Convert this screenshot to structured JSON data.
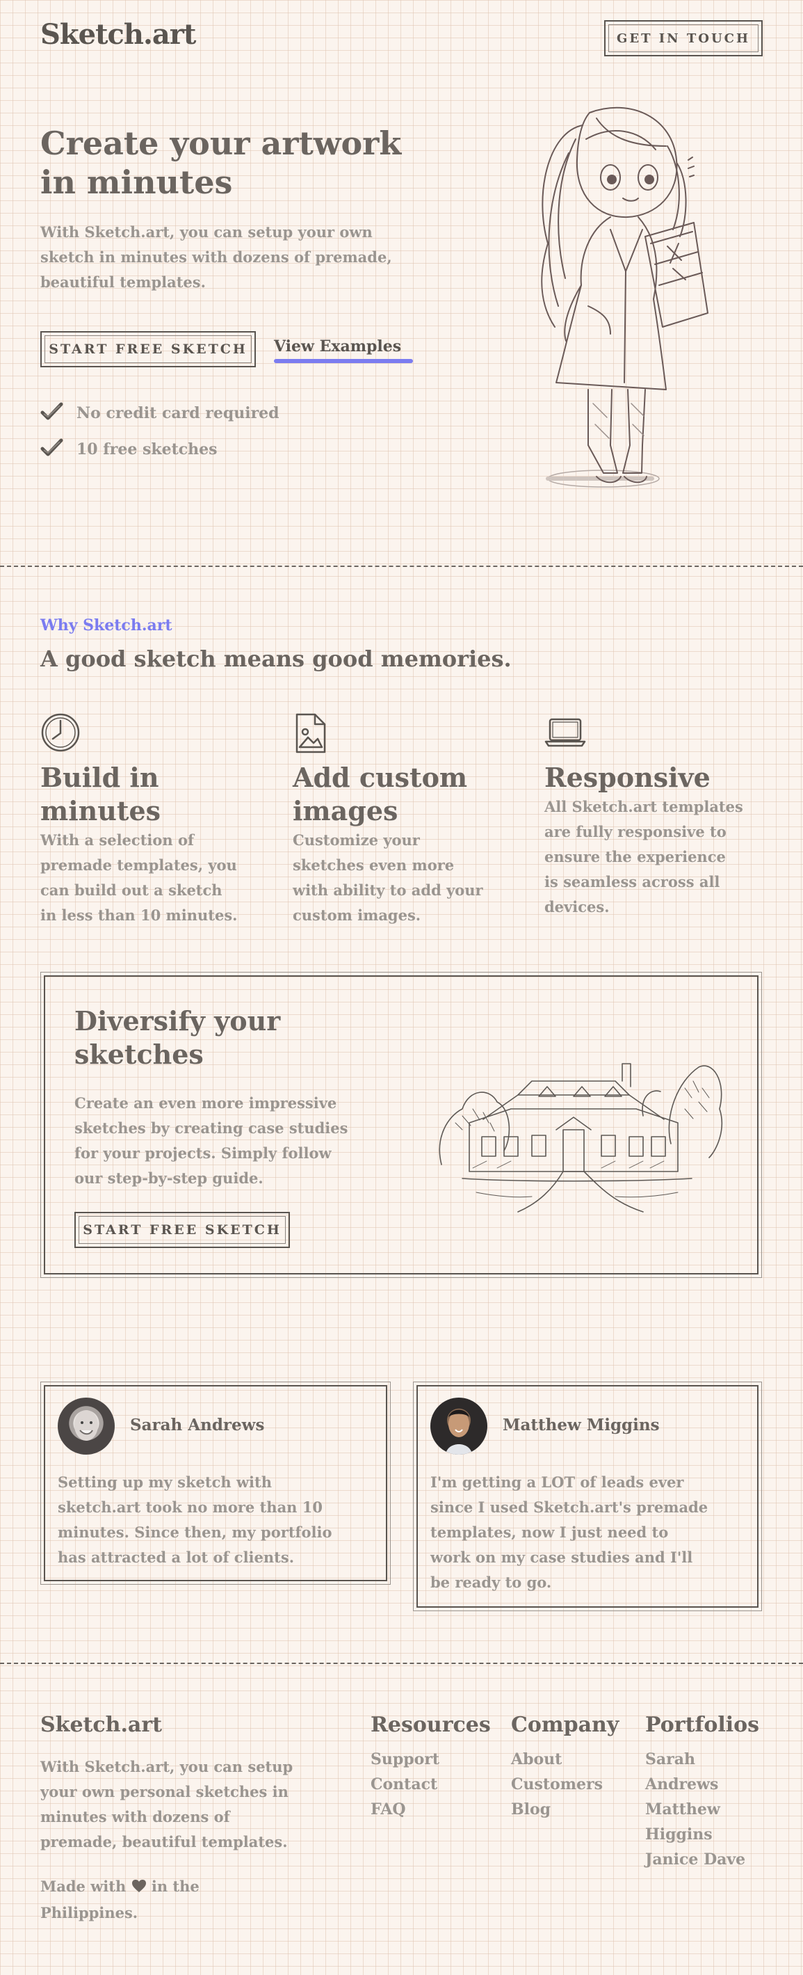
{
  "header": {
    "logo": "Sketch.art",
    "cta_label": "GET IN TOUCH"
  },
  "hero": {
    "title_line1": "Create your artwork",
    "title_line2": "in minutes",
    "description_line1": "With Sketch.art, you can setup your own",
    "description_line2": "sketch in minutes with dozens of premade,",
    "description_line3": "beautiful templates.",
    "primary_button": "START FREE SKETCH",
    "secondary_link": "View Examples",
    "checks": [
      "No credit card required",
      "10 free sketches"
    ]
  },
  "why": {
    "eyebrow": "Why Sketch.art",
    "heading": "A good sketch means good memories.",
    "features": [
      {
        "icon": "clock-icon",
        "title_line1": "Build in",
        "title_line2": "minutes",
        "lines": [
          "With a selection of",
          "premade templates, you",
          "can build out a sketch",
          "in less than 10 minutes."
        ]
      },
      {
        "icon": "image-file-icon",
        "title_line1": "Add custom",
        "title_line2": "images",
        "lines": [
          "Customize your",
          "sketches even more",
          "with ability to add your",
          "custom images."
        ]
      },
      {
        "icon": "laptop-icon",
        "title_line1": "Responsive",
        "title_line2": "",
        "lines": [
          "All Sketch.art templates",
          "are fully responsive to",
          "ensure the experience",
          "is seamless across all",
          "devices."
        ]
      }
    ]
  },
  "diversify": {
    "title_line1": "Diversify your",
    "title_line2": "sketches",
    "lines": [
      "Create an even more impressive",
      "sketches by creating case studies",
      "for your projects. Simply follow",
      "our step-by-step guide."
    ],
    "button": "START FREE SKETCH"
  },
  "testimonials": [
    {
      "name": "Sarah Andrews",
      "lines": [
        "Setting up my sketch with",
        "sketch.art took no more than 10",
        "minutes. Since then, my portfolio",
        "has attracted a lot of clients."
      ]
    },
    {
      "name": "Matthew Miggins",
      "lines": [
        "I'm getting a LOT of leads ever",
        "since I used Sketch.art's premade",
        "templates, now I just need to",
        "work on my case studies and I'll",
        "be ready to go."
      ]
    }
  ],
  "footer": {
    "logo": "Sketch.art",
    "lines": [
      "With Sketch.art, you can setup",
      "your own personal sketches in",
      "minutes with dozens of",
      "premade, beautiful templates."
    ],
    "made_with_prefix": "Made with",
    "made_with_suffix": "in the",
    "made_with_line2": "Philippines.",
    "columns": [
      {
        "heading": "Resources",
        "links": [
          "Support",
          "Contact",
          "FAQ"
        ]
      },
      {
        "heading": "Company",
        "links": [
          "About",
          "Customers",
          "Blog"
        ]
      },
      {
        "heading": "Portfolios",
        "links": [
          "Sarah",
          "Andrews",
          "Matthew",
          "Higgins",
          "Janice Dave"
        ]
      }
    ]
  },
  "colors": {
    "accent": "#7b7cf0",
    "ink": "#5a5550",
    "muted_text": "#9a9590",
    "paper": "#fbf4ee"
  }
}
